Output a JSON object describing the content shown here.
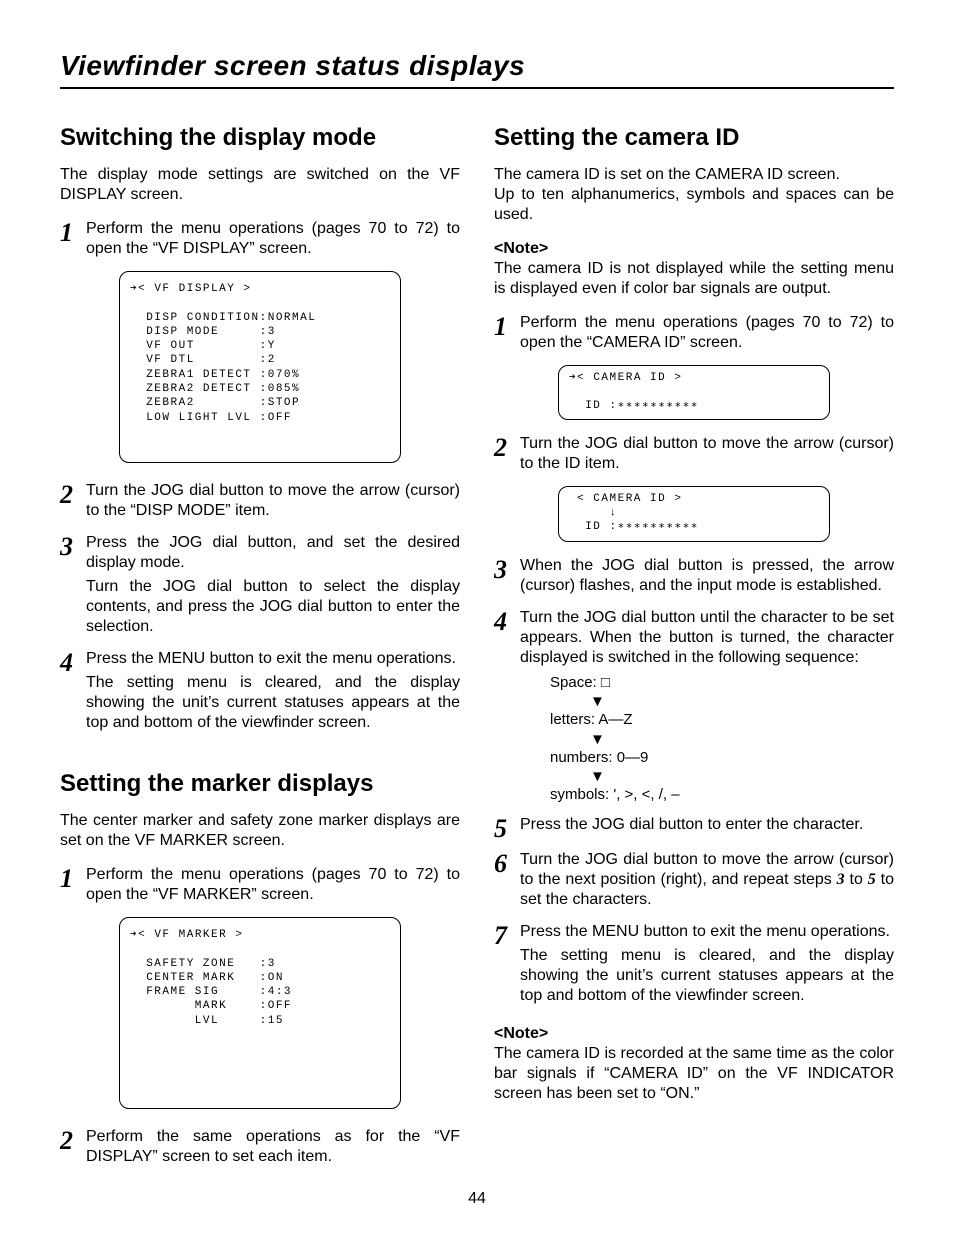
{
  "page_title": "Viewfinder screen status displays",
  "page_number": "44",
  "left": {
    "sec1_title": "Switching the display mode",
    "sec1_intro": "The display mode settings are switched on the VF DISPLAY screen.",
    "s1_1": "Perform the menu operations (pages 70 to 72) to open the “VF DISPLAY” screen.",
    "vf_display_screen": "➔< VF DISPLAY >\n\n  DISP CONDITION:NORMAL\n  DISP MODE     :3\n  VF OUT        :Y\n  VF DTL        :2\n  ZEBRA1 DETECT :070%\n  ZEBRA2 DETECT :085%\n  ZEBRA2        :STOP\n  LOW LIGHT LVL :OFF",
    "s1_2": "Turn the JOG dial button to move the arrow (cursor) to the “DISP MODE” item.",
    "s1_3a": "Press the JOG dial button, and set the desired display mode.",
    "s1_3b": "Turn the JOG dial button to select the display contents, and press the JOG dial button to enter the selection.",
    "s1_4a": "Press the MENU button to exit the menu operations.",
    "s1_4b": "The setting menu is cleared, and the display showing the unit’s current statuses appears at the top and bottom of the viewfinder screen.",
    "sec2_title": "Setting the marker displays",
    "sec2_intro": "The center marker and safety zone marker displays are set on the VF MARKER screen.",
    "s2_1": "Perform the menu operations (pages 70 to 72) to open the “VF MARKER” screen.",
    "vf_marker_screen": "➔< VF MARKER >\n\n  SAFETY ZONE   :3\n  CENTER MARK   :ON\n  FRAME SIG     :4:3\n        MARK    :OFF\n        LVL     :15",
    "s2_2": "Perform the same operations as for the “VF DISPLAY” screen to set each item."
  },
  "right": {
    "sec3_title": "Setting the camera ID",
    "sec3_intro": "The camera ID is set on the CAMERA ID screen.\nUp to ten alphanumerics, symbols and spaces can be used.",
    "note1_label": "<Note>",
    "note1_body": "The camera ID is not displayed while the setting menu is displayed even if color bar signals are output.",
    "s3_1": "Perform the menu operations (pages 70 to 72) to open the “CAMERA ID” screen.",
    "cam_id_screen1": "➔< CAMERA ID >\n\n  ID :∗∗∗∗∗∗∗∗∗∗",
    "s3_2": "Turn the JOG dial button to move the arrow (cursor) to the ID item.",
    "cam_id_screen2": " < CAMERA ID >\n     ↓\n  ID :∗∗∗∗∗∗∗∗∗∗",
    "s3_3": "When the JOG dial button is pressed, the arrow (cursor) flashes, and the input mode is established.",
    "s3_4": "Turn the JOG dial button until the character to be set appears.  When the button is turned, the character displayed is switched in the following sequence:",
    "seq_space": "Space: □",
    "seq_letters": "letters: A—Z",
    "seq_numbers": "numbers: 0—9",
    "seq_symbols": "symbols: ', >, <, /, –",
    "s3_5": "Press the JOG dial button to enter the character.",
    "s3_6a": "Turn the JOG dial button to move the arrow (cursor) to the next position (right), and repeat steps ",
    "s3_6b": " to ",
    "s3_6c": " to set the characters.",
    "s3_6_n1": "3",
    "s3_6_n2": "5",
    "s3_7a": "Press the MENU button to exit the menu operations.",
    "s3_7b": "The setting menu is cleared, and the display showing the unit’s current statuses appears at the top and bottom of the viewfinder screen.",
    "note2_label": "<Note>",
    "note2_body": "The camera ID is recorded at the same time as the color bar signals if “CAMERA ID” on the VF INDICATOR screen has been set to “ON.”"
  }
}
